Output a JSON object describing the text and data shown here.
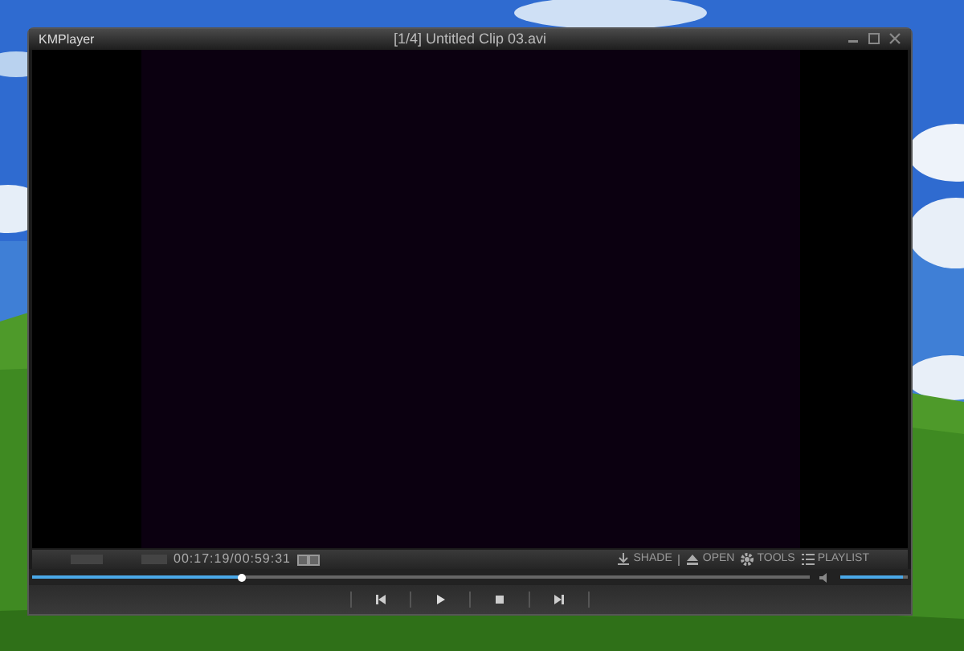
{
  "window": {
    "app_name": "KMPlayer",
    "title": "[1/4] Untitled Clip 03.avi"
  },
  "status": {
    "time": "00:17:19/00:59:31"
  },
  "toolbar": [
    {
      "label": "SHADE",
      "kind": "download"
    },
    {
      "label": "OPEN",
      "kind": "eject"
    },
    {
      "label": "TOOLS",
      "kind": "gear"
    },
    {
      "label": "PLAYLIST",
      "kind": "list"
    }
  ],
  "seek": {
    "level": 0.27
  },
  "volume": {
    "level": 0.92
  },
  "controls": [
    {
      "kind": "previous"
    },
    {
      "kind": "play"
    },
    {
      "kind": "stop"
    },
    {
      "kind": "next"
    }
  ]
}
